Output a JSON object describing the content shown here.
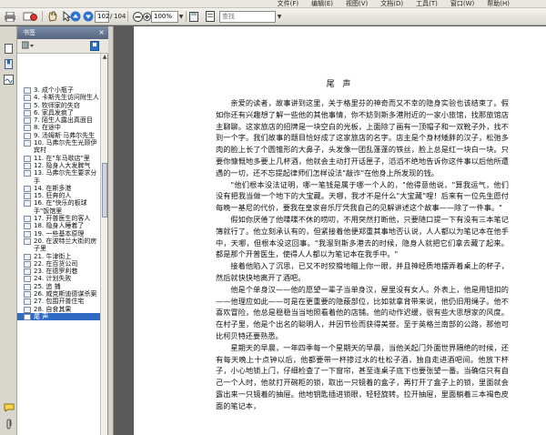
{
  "menubar": {
    "items": [
      "文件(F)",
      "编辑(E)",
      "视图(V)",
      "文档(D)",
      "工具(T)",
      "窗口(W)",
      "帮助(H)"
    ]
  },
  "toolbar": {
    "page_current": "102",
    "page_separator": "/",
    "page_total": "104",
    "zoom": "100%",
    "search_placeholder": "查找"
  },
  "panel": {
    "title": "书签",
    "close_glyph": "×"
  },
  "bookmarks": [
    "3. 成个小瓶子",
    "4. 卡斯先生访问附生人",
    "5. 牧师家的失窃",
    "6. 家具发疯了",
    "7. 陌生人露出真面目",
    "8. 在途中",
    "9. 汤姆斯·马弗尔先生",
    "10. 马弗尔先生光顾伊宾村",
    "11. 在\"车马歇店\"里",
    "12. 隐身人大发脾气",
    "13. 马弗尔先生要求分手",
    "14. 在斯多港",
    "15. 狂奔的人",
    "16. 在\"快乐的板球手\"饭馆里",
    "17. 开普医生的客人",
    "18. 隐身人睡着了",
    "19. 一些基本原理",
    "20. 在波特兰大街的房子里",
    "21. 牛津街上",
    "22. 在百货公司",
    "23. 在德罗利巷",
    "24. 计划失败",
    "25. 追 捕",
    "26. 威克斯迪德谋杀案",
    "27. 包围开普住宅",
    "28. 自食其果",
    "尾 声"
  ],
  "document": {
    "title": "尾 声",
    "paragraphs": [
      "亲爱的读者，故事讲到这里，关于格里芬的神奇而又不幸的隐身实验也该结束了。假如你还有兴趣想了解一些他的其他事情，你不妨到斯多港附近的一家小旅馆，找那旅馆店主聊聊。这家旅店的招牌是一块空白的光板，上面除了画有一顶帽子和一双靴子外，找不到一个字。我们故事的题目恰好成了这家旅店的名字。店主是个身材矮胖的汉子，松弛多肉的脸上长了个圆锥形的大鼻子，头发像一团乱蓬蓬的铁丝，脸上总是红一块白一块。只要你慷慨地多要上几杯酒，他就会主动打开话匣子，滔滔不绝地告诉你这件事以后他所遭遇的一切，还不忘提起律师们怎样设法\"敲诈\"在他身上所发现的钱。",
      "\"他们根本没法证明，哪一笔钱是属于哪一个人的，\"他得意他说，\"算我运气，他们没有把我当做一个地下的大宝藏。天哪，我才不是什么\"大宝藏\"哩！后来有一位先生愿付每晚一基尼的代价，要我在皇家音乐厅凭我自己的见解讲述这个故事——除了一件事。\"",
      "假如你厌倦了他喋喋不休的唠叨，不用突然打断他，只要随口提一下有没有三本笔记簿就行了。他立刻承认有的，但紧接着他便郑重其事地否认说，人人都以为笔记本在他手中，天哪，但根本没这回事。\"我溜到斯多港去的时候，隐身人就把它们拿去藏了起来。都是那个开普医生，使得人人都以为笔记本在我手中。\"",
      "接着他陷入了沉思，已又不时狡猾地瞄上你一眼，并且神经质地摆弄着桌上的杯子，然后就快快地离开了酒吧。",
      "他是个单身汉——他的愿望一辈子当单身汉，屋里没有女人。外表上，他是用钮扣的——他理应如此——可是在更重要的隐蔽部位，比如就拿背带来说，他仍旧用绳子。他不喜欢冒险，他总是稳稳当当地照看着他的店铺。他的动作迟缓，很有些大思想家的风度。在村子里，他是个出名的聪明人，并因节俭而获得美誉。至于英格兰南部的公路，那他可比柯贝特还要熟悉。",
      "星期天的早晨，一年四季每一个星期天的早晨，当他关起门外面世界隔绝的时候，还有每天晚上十点钟以后，他都要带一杯掺过水的杜松子酒，独自走进酒吧间。他放下杯子，小心地锁上门，仔细检查了一下窗帘，甚至连桌子底下也要张望一番。当确信只有自己一个人时，他就打开碗柜的锁，取出一只镜着的盒子，再打开了盒子上的锁，里面就会露出来一只镜着的抽屉。他地钥匙插进锁眼，轻轻旋转。拉开抽屉，里面躺着三本褐色皮面的笔记本，"
    ]
  },
  "colors": {
    "panel_header": "#55657f",
    "selected_bookmark": "#316ac5",
    "workspace_bg": "#5a5a5a"
  }
}
